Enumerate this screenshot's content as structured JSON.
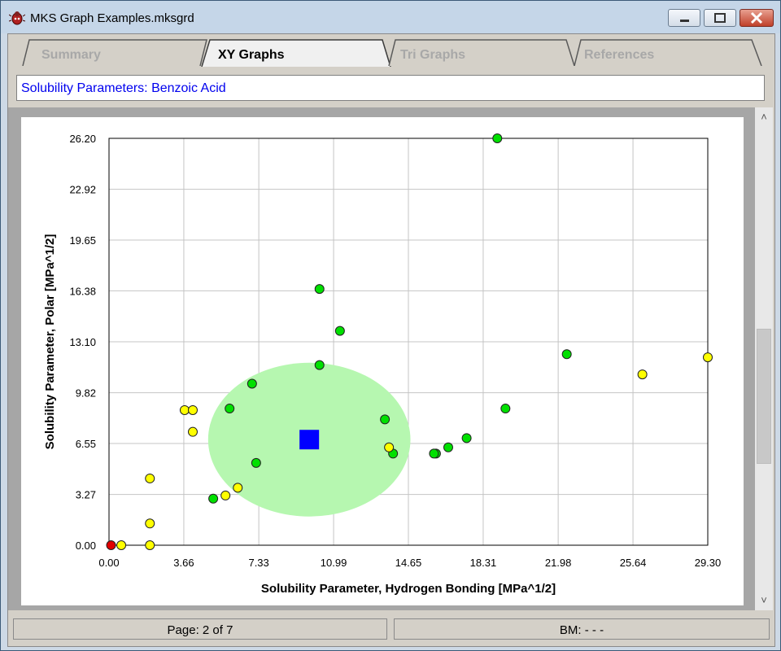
{
  "window": {
    "title": "MKS Graph Examples.mksgrd"
  },
  "tabs": [
    {
      "label": "Summary",
      "active": false
    },
    {
      "label": "XY Graphs",
      "active": true
    },
    {
      "label": "Tri Graphs",
      "active": false
    },
    {
      "label": "References",
      "active": false
    }
  ],
  "header": {
    "subtitle": "Solubility Parameters: Benzoic Acid"
  },
  "status": {
    "page": "Page: 2 of 7",
    "bookmark": "BM: - - -"
  },
  "colors": {
    "green": "#00e000",
    "yellow": "#ffff00",
    "red": "#e00000",
    "center": "#0000ff",
    "ellipse": "#b6f7b0"
  },
  "chart_data": {
    "type": "scatter",
    "xlabel": "Solubility Parameter, Hydrogen Bonding [MPa^1/2]",
    "ylabel": "Solubility Parameter, Polar [MPa^1/2]",
    "xlim": [
      0,
      29.3
    ],
    "ylim": [
      0,
      26.2
    ],
    "x_ticks": [
      "0.00",
      "3.66",
      "7.33",
      "10.99",
      "14.65",
      "18.31",
      "21.98",
      "25.64",
      "29.30"
    ],
    "y_ticks": [
      "0.00",
      "3.27",
      "6.55",
      "9.82",
      "13.10",
      "16.38",
      "19.65",
      "22.92",
      "26.20"
    ],
    "grid": true,
    "center": {
      "x": 9.8,
      "y": 6.8
    },
    "sphere": {
      "cx": 9.8,
      "cy": 6.8,
      "rx": 4.95,
      "ry": 4.95
    },
    "green_points": [
      [
        19.0,
        26.2
      ],
      [
        10.3,
        16.5
      ],
      [
        11.3,
        13.8
      ],
      [
        22.4,
        12.3
      ],
      [
        10.3,
        11.6
      ],
      [
        7.0,
        10.4
      ],
      [
        5.9,
        8.8
      ],
      [
        19.4,
        8.8
      ],
      [
        13.5,
        8.1
      ],
      [
        17.5,
        6.9
      ],
      [
        16.6,
        6.3
      ],
      [
        16.0,
        5.9
      ],
      [
        15.9,
        5.9
      ],
      [
        13.9,
        5.9
      ],
      [
        7.2,
        5.3
      ],
      [
        5.1,
        3.0
      ]
    ],
    "yellow_points": [
      [
        29.3,
        12.1
      ],
      [
        26.1,
        11.0
      ],
      [
        3.7,
        8.7
      ],
      [
        4.1,
        8.7
      ],
      [
        4.1,
        7.3
      ],
      [
        13.7,
        6.3
      ],
      [
        6.3,
        3.7
      ],
      [
        5.7,
        3.2
      ],
      [
        2.0,
        4.3
      ],
      [
        2.0,
        1.4
      ],
      [
        2.0,
        0.0
      ],
      [
        0.6,
        0.0
      ]
    ],
    "red_points": [
      [
        0.1,
        0.0
      ]
    ]
  }
}
